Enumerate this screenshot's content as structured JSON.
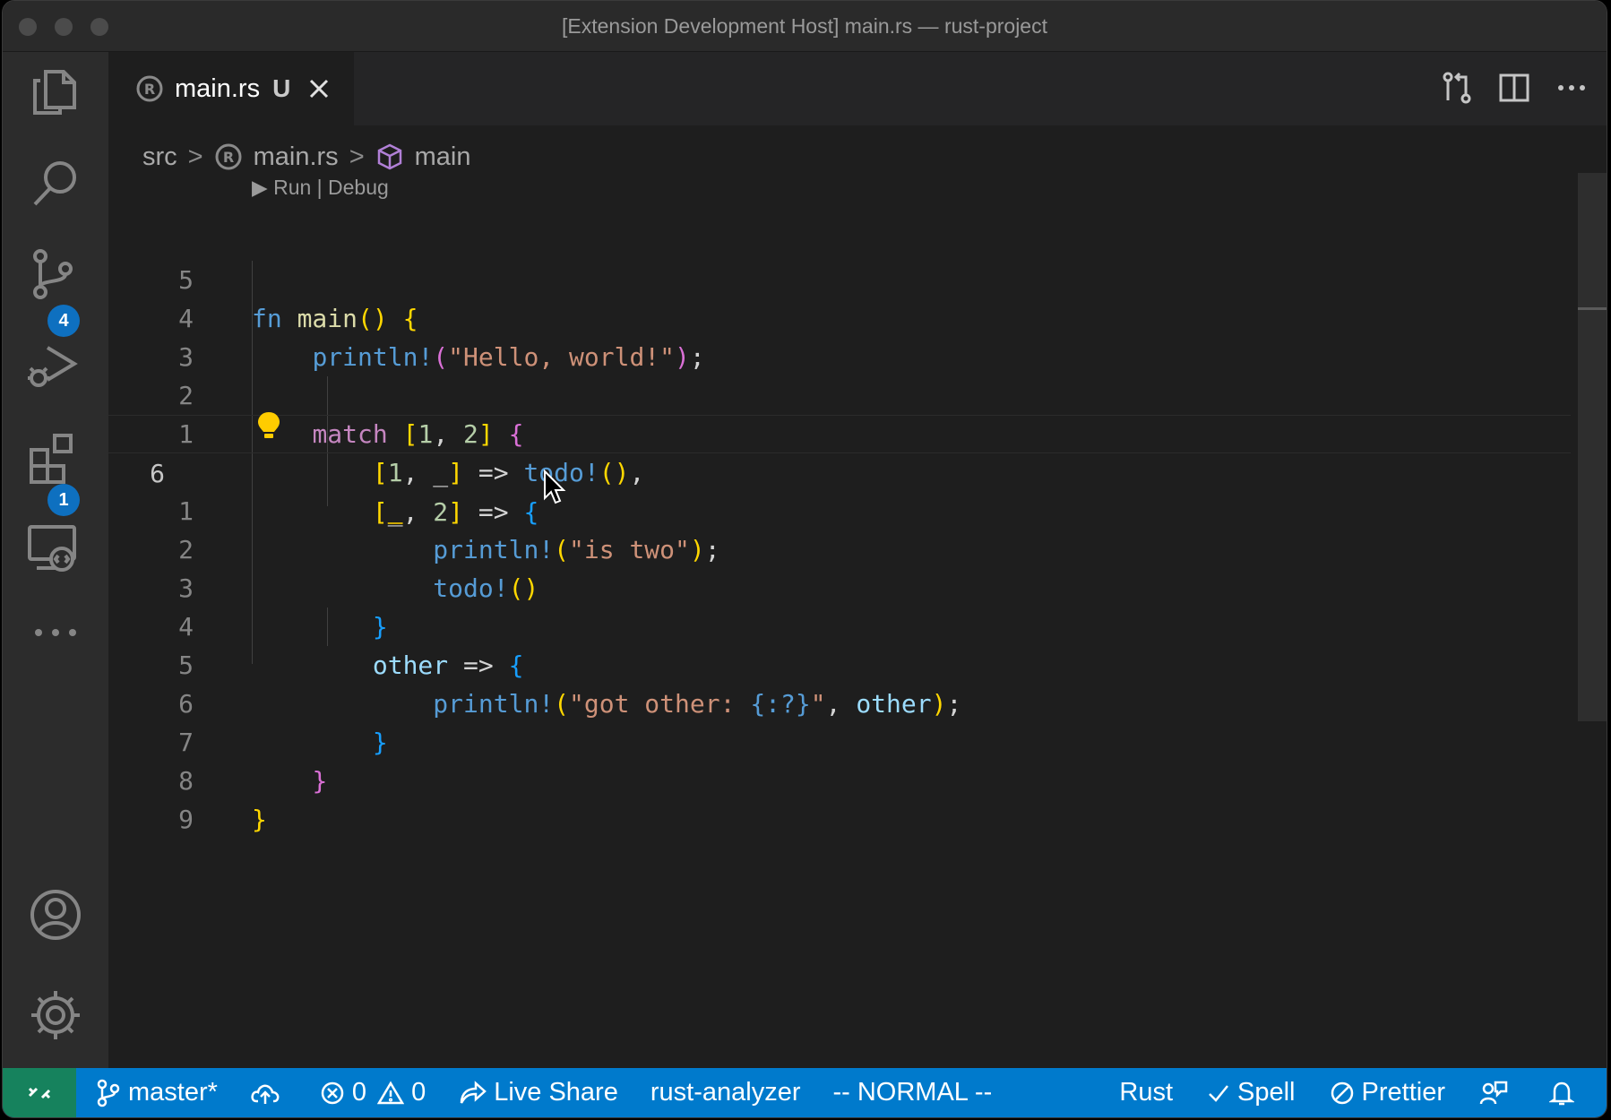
{
  "window": {
    "title": "[Extension Development Host] main.rs — rust-project"
  },
  "activity_bar": {
    "scm_badge": "4",
    "extensions_badge": "1"
  },
  "tab": {
    "name": "main.rs",
    "status": "U"
  },
  "breadcrumb": {
    "folder": "src",
    "file": "main.rs",
    "symbol": "main"
  },
  "codelens": {
    "label": "▶ Run | Debug"
  },
  "code": {
    "line_numbers": [
      "5",
      "4",
      "3",
      "2",
      "1",
      "6",
      "1",
      "2",
      "3",
      "4",
      "5",
      "6",
      "7",
      "8",
      "9"
    ],
    "l0": {
      "kw": "fn",
      "name": "main",
      "parens": "()",
      "brace": "{"
    },
    "l1": {
      "macro": "println!",
      "open": "(",
      "str": "\"Hello, world!\"",
      "close": ")",
      "semi": ";"
    },
    "l3": {
      "kw": "match",
      "ob": "[",
      "n1": "1",
      "comma": ",",
      "n2": "2",
      "cb": "]",
      "brace": "{"
    },
    "l4": {
      "ob": "[",
      "n1": "1",
      "comma": ",",
      "us": "_",
      "cb": "]",
      "arrow": "=>",
      "macro": "todo!",
      "parens": "()",
      "tail": ","
    },
    "l5": {
      "ob": "[",
      "us": "_",
      "comma": ",",
      "n2": "2",
      "cb": "]",
      "arrow": "=>",
      "brace": "{"
    },
    "l6": {
      "macro": "println!",
      "open": "(",
      "str": "\"is two\"",
      "close": ")",
      "semi": ";"
    },
    "l7": {
      "macro": "todo!",
      "parens": "()"
    },
    "l8": {
      "brace": "}"
    },
    "l9": {
      "var": "other",
      "arrow": "=>",
      "brace": "{"
    },
    "l10": {
      "macro": "println!",
      "open": "(",
      "str1": "\"got other: ",
      "fmt": "{:?}",
      "str2": "\"",
      "comma": ",",
      "var": "other",
      "close": ")",
      "semi": ";"
    },
    "l11": {
      "brace": "}"
    },
    "l12": {
      "brace": "}"
    },
    "l13": {
      "brace": "}"
    }
  },
  "status_bar": {
    "branch": "master*",
    "errors": "0",
    "warnings": "0",
    "live_share": "Live Share",
    "rust_analyzer": "rust-analyzer",
    "vim_mode": "-- NORMAL --",
    "language": "Rust",
    "spell": "Spell",
    "prettier": "Prettier"
  },
  "colors": {
    "accent": "#007acc",
    "remote": "#16825d",
    "badge": "#0e70c0"
  }
}
